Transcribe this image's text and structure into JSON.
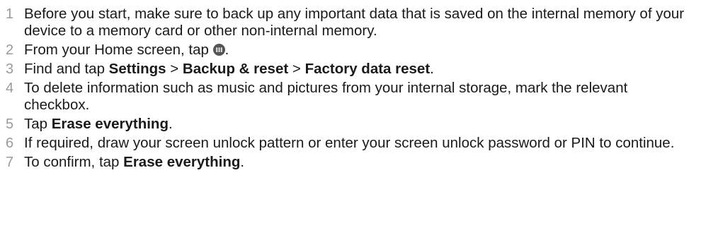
{
  "steps": [
    {
      "number": "1",
      "text": "Before you start, make sure to back up any important data that is saved on the internal memory of your device to a memory card or other non-internal memory."
    },
    {
      "number": "2",
      "before": "From your Home screen, tap ",
      "icon": "apps-grid-icon",
      "after": "."
    },
    {
      "number": "3",
      "prefix": "Find and tap ",
      "item1": "Settings",
      "sep1": " > ",
      "item2": "Backup & reset",
      "sep2": " > ",
      "item3": "Factory data reset",
      "suffix": "."
    },
    {
      "number": "4",
      "text": "To delete information such as music and pictures from your internal storage, mark the relevant checkbox."
    },
    {
      "number": "5",
      "prefix": "Tap ",
      "bold": "Erase everything",
      "suffix": "."
    },
    {
      "number": "6",
      "text": "If required, draw your screen unlock pattern or enter your screen unlock password or PIN to continue."
    },
    {
      "number": "7",
      "prefix": "To confirm, tap ",
      "bold": "Erase everything",
      "suffix": "."
    }
  ]
}
